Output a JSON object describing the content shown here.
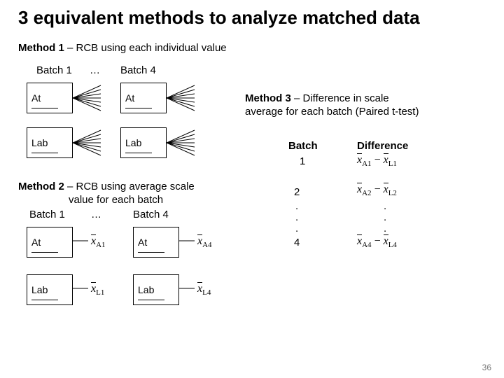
{
  "title": "3 equivalent methods to analyze matched data",
  "method1": {
    "prefix": "Method 1 ",
    "suffix": "– RCB using each individual value",
    "batch1": "Batch 1",
    "dots": "…",
    "batch4": "Batch 4",
    "at": "At",
    "lab": "Lab"
  },
  "method2": {
    "prefix": "Method 2 ",
    "line1suffix": "– RCB using average scale",
    "line2": "value for each batch",
    "batch1": "Batch 1",
    "dots": "…",
    "batch4": "Batch 4",
    "at": "At",
    "lab": "Lab",
    "xA1": "x",
    "xA1s": "A1",
    "xL1": "x",
    "xL1s": "L1",
    "xA4": "x",
    "xA4s": "A4",
    "xL4": "x",
    "xL4s": "L4"
  },
  "method3": {
    "prefix": "Method 3 ",
    "line1suffix": "– Difference in scale",
    "line2": "average for each batch (Paired t-test)",
    "colBatch": "Batch",
    "colDiff": "Difference",
    "rows": [
      "1",
      "2",
      ".",
      ".",
      ".",
      "4"
    ],
    "d1a": "x",
    "d1as": "A1",
    "d1b": "x",
    "d1bs": "L1",
    "d2a": "x",
    "d2as": "A2",
    "d2b": "x",
    "d2bs": "L2",
    "d4a": "x",
    "d4as": "A4",
    "d4b": "x",
    "d4bs": "L4",
    "dots": "."
  },
  "pagenum": "36"
}
